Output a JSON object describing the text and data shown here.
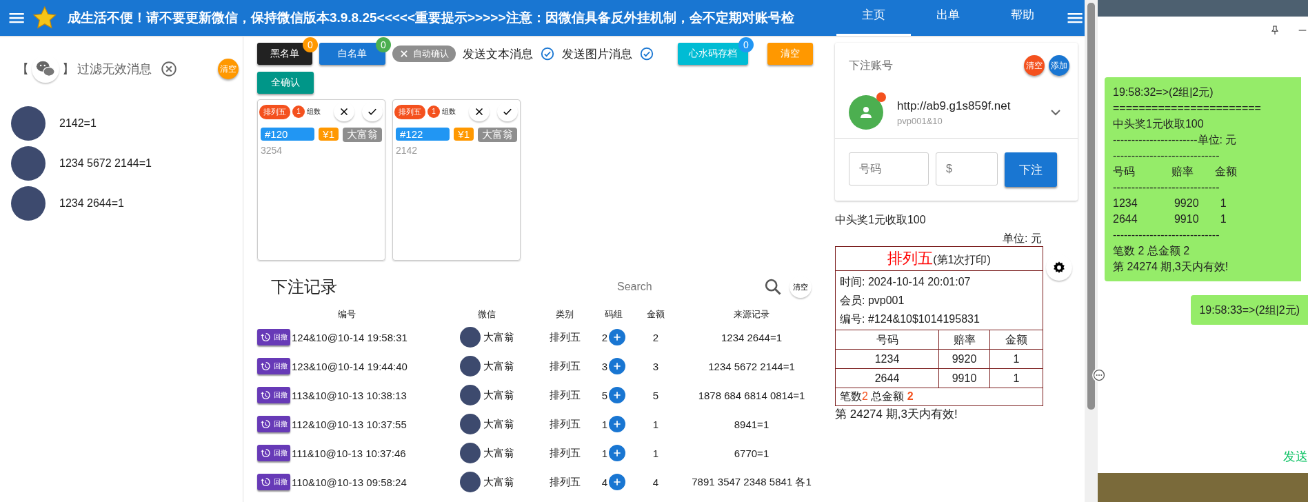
{
  "header": {
    "marquee": "成生活不便！请不要更新微信，保持微信版本3.9.8.25<<<<<重要提示>>>>>注意：因微信具备反外挂机制，会不定期对账号检",
    "nav": [
      {
        "label": "主页",
        "selected": true
      },
      {
        "label": "出单",
        "selected": false
      },
      {
        "label": "帮助",
        "selected": false
      }
    ]
  },
  "filter": {
    "open_bracket": "【",
    "close_bracket": "】",
    "label": "过滤无效消息",
    "clear": "清空"
  },
  "messages": [
    {
      "text": "2142=1"
    },
    {
      "text": "1234 5672 2144=1"
    },
    {
      "text": "1234 2644=1"
    }
  ],
  "toolbar": {
    "buttons": [
      {
        "kind": "dark",
        "label": "黑名单",
        "badge": "0",
        "color": "#ff9800"
      },
      {
        "kind": "blue",
        "label": "白名单",
        "badge": "0",
        "color": "#4caf50"
      },
      {
        "kind": "chip",
        "label": "自动确认"
      },
      {
        "kind": "toggle",
        "label": "发送文本消息",
        "checked": true
      },
      {
        "kind": "toggle",
        "label": "发送图片消息",
        "checked": true
      },
      {
        "kind": "cyan",
        "label": "心水码存档",
        "badge": "0",
        "color": "#2196f3"
      },
      {
        "kind": "orange",
        "label": "清空"
      },
      {
        "kind": "teal",
        "label": "全确认"
      }
    ]
  },
  "cards": [
    {
      "lottery": "排列五",
      "count": "1",
      "count_label": "组数",
      "id": "#120",
      "amount": "¥1",
      "user": "大富翁",
      "numbers": "3254"
    },
    {
      "lottery": "排列五",
      "count": "1",
      "count_label": "组数",
      "id": "#122",
      "amount": "¥1",
      "user": "大富翁",
      "numbers": "2142"
    }
  ],
  "records": {
    "title": "下注记录",
    "search": {
      "placeholder": "Search"
    },
    "clear": "清空",
    "columns": [
      "编号",
      "微信",
      "类别",
      "码组",
      "金额",
      "来源记录"
    ],
    "rows": [
      {
        "undo": "回撤",
        "id": "124&10@10-14 19:58:31",
        "user": "大富翁",
        "type": "排列五",
        "group": "2",
        "amount": "2",
        "source": "1234 2644=1"
      },
      {
        "undo": "回撤",
        "id": "123&10@10-14 19:44:40",
        "user": "大富翁",
        "type": "排列五",
        "group": "3",
        "amount": "3",
        "source": "1234 5672 2144=1"
      },
      {
        "undo": "回撤",
        "id": "113&10@10-13 10:38:13",
        "user": "大富翁",
        "type": "排列五",
        "group": "5",
        "amount": "5",
        "source": "1878 684 6814 0814=1"
      },
      {
        "undo": "回撤",
        "id": "112&10@10-13 10:37:55",
        "user": "大富翁",
        "type": "排列五",
        "group": "1",
        "amount": "1",
        "source": "8941=1"
      },
      {
        "undo": "回撤",
        "id": "111&10@10-13 10:37:46",
        "user": "大富翁",
        "type": "排列五",
        "group": "1",
        "amount": "1",
        "source": "6770=1"
      },
      {
        "undo": "回撤",
        "id": "110&10@10-13 09:58:24",
        "user": "大富翁",
        "type": "排列五",
        "group": "4",
        "amount": "4",
        "source": "7891 3547 2348 5841 各1"
      }
    ]
  },
  "account": {
    "title": "下注账号",
    "clear": "清空",
    "add": "添加",
    "url": "http://ab9.g1s859f.net",
    "user": "pvp001&10",
    "number_field": {
      "placeholder": "号码"
    },
    "amount_field": {
      "placeholder": "$"
    },
    "submit": "下注"
  },
  "receipt": {
    "note": "中头奖1元收取100",
    "unit": "单位: 元",
    "title": "排列五",
    "subtitle": "(第1次打印)",
    "info": [
      "时间: 2024-10-14 20:01:07",
      "会员: pvp001",
      "编号: #124&10$1014195831"
    ],
    "columns": [
      "号码",
      "赔率",
      "金额"
    ],
    "rows": [
      [
        "1234",
        "9920",
        "1"
      ],
      [
        "2644",
        "9910",
        "1"
      ]
    ],
    "summary": "笔数**2** 总金额 **2**",
    "footer": "第 24274 期,3天内有效!"
  },
  "chat": {
    "messages": [
      {
        "kind": "left",
        "lines": [
          "19:58:32=>(2组|2元)",
          "=======================",
          "中头奖1元收取100",
          "-----------------------单位: 元",
          "-----------------------------",
          "号码            赔率       金额",
          "-----------------------------",
          "1234            9920       1",
          "2644            9910       1",
          "-----------------------------",
          "笔数 2 总金额 2",
          "第 24274 期,3天内有效!"
        ]
      },
      {
        "kind": "right",
        "lines": [
          "19:58:33=>(2组|2元)"
        ]
      }
    ],
    "send": "发送"
  }
}
